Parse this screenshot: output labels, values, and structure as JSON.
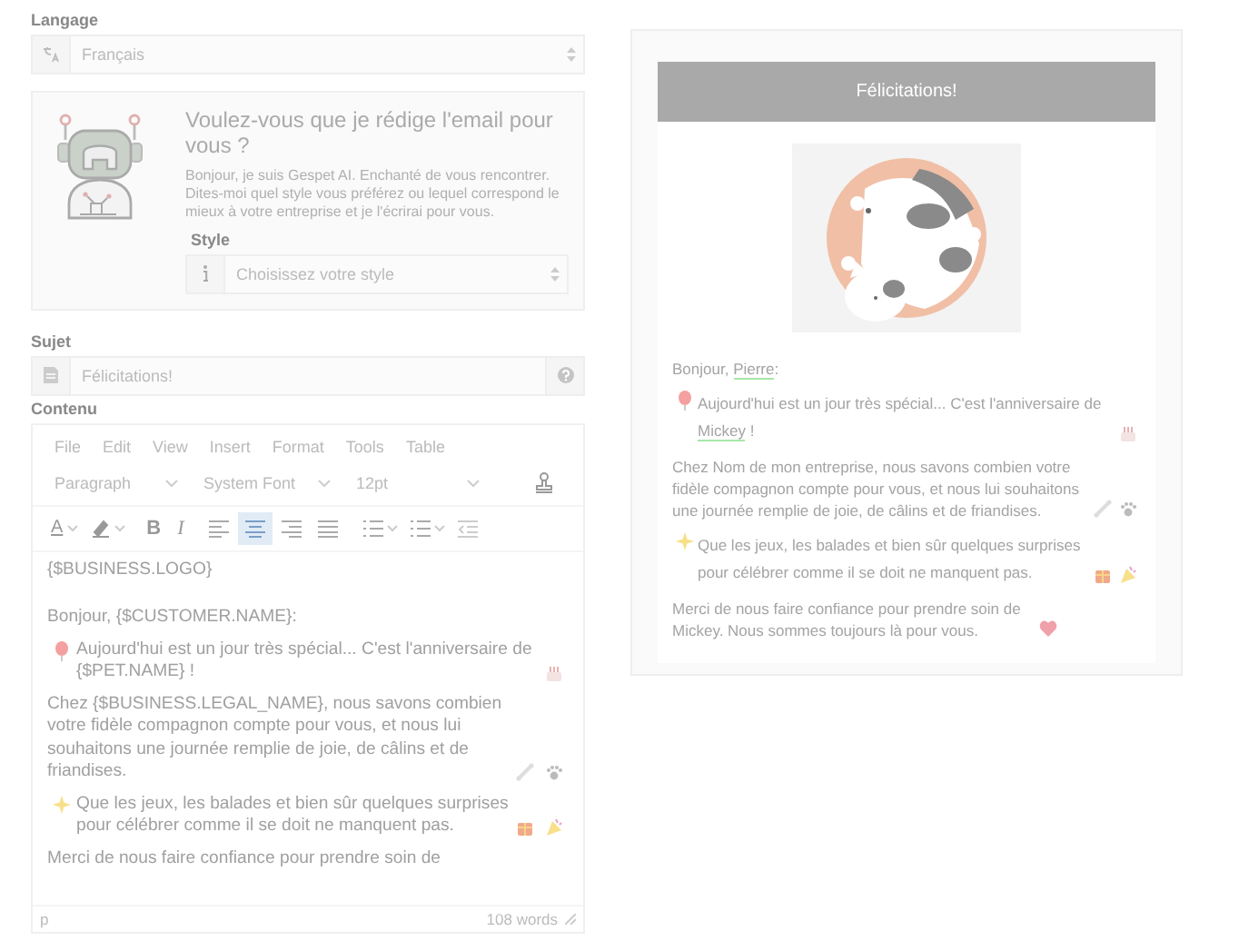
{
  "language": {
    "label": "Langage",
    "value": "Français"
  },
  "assistant": {
    "title": "Voulez-vous que je rédige l'email pour vous ?",
    "text": "Bonjour, je suis Gespet AI. Enchanté de vous rencontrer. Dites-moi quel style vous préférez ou lequel correspond le mieux à votre entreprise et je l'écrirai pour vous.",
    "style": {
      "label": "Style",
      "placeholder": "Choisissez votre style"
    }
  },
  "subject": {
    "label": "Sujet",
    "value": "Félicitations!"
  },
  "content": {
    "label": "Contenu",
    "menu": [
      "File",
      "Edit",
      "View",
      "Insert",
      "Format",
      "Tools",
      "Table"
    ],
    "block_format": "Paragraph",
    "font_family": "System Font",
    "font_size": "12pt",
    "toolbar": [
      {
        "kind": "text-color",
        "label": "A",
        "selected": false
      },
      {
        "kind": "highlight",
        "selected": false
      },
      {
        "kind": "bold",
        "label": "B",
        "selected": false
      },
      {
        "kind": "italic",
        "label": "I",
        "selected": false
      },
      {
        "kind": "align-left",
        "selected": false
      },
      {
        "kind": "align-center",
        "selected": true
      },
      {
        "kind": "align-right",
        "selected": false
      },
      {
        "kind": "justify",
        "selected": false
      },
      {
        "kind": "bullet-list",
        "selected": false
      },
      {
        "kind": "numbered-list",
        "selected": false
      },
      {
        "kind": "outdent",
        "selected": false
      }
    ],
    "body": [
      {
        "kind": "logo",
        "parts": [
          {
            "text": "{$BUSINESS.LOGO}",
            "merge": false
          }
        ]
      },
      {
        "kind": "greeting",
        "parts": [
          {
            "text": "Bonjour, {$CUSTOMER.NAME}:",
            "merge": false
          }
        ]
      },
      {
        "kind": "birthday",
        "parts": [
          {
            "text": "Aujourd'hui est un jour très spécial... C'est l'anniversaire de {$PET.NAME} !",
            "merge": false
          }
        ]
      },
      {
        "kind": "treats",
        "parts": [
          {
            "text": "Chez {$BUSINESS.LEGAL_NAME}, nous savons combien votre fidèle compagnon compte pour vous, et nous lui souhaitons une journée remplie de joie, de câlins et de friandises.",
            "merge": false
          }
        ]
      },
      {
        "kind": "wishes",
        "parts": [
          {
            "text": "Que les jeux, les balades et bien sûr quelques surprises pour célébrer comme il se doit ne manquent pas.",
            "merge": false
          }
        ]
      },
      {
        "kind": "thanks-cut",
        "parts": [
          {
            "text": "Merci de nous faire confiance pour prendre soin de",
            "merge": false
          }
        ]
      }
    ],
    "status_path": "p",
    "word_count": "108 words"
  },
  "preview": {
    "header": "Félicitations!",
    "body": [
      {
        "kind": "greeting",
        "parts": [
          {
            "text": "Bonjour, ",
            "merge": false
          },
          {
            "text": "Pierre",
            "merge": true
          },
          {
            "text": ":",
            "merge": false
          }
        ]
      },
      {
        "kind": "birthday",
        "parts": [
          {
            "text": "Aujourd'hui est un jour très spécial... C'est l'anniversaire de ",
            "merge": false
          },
          {
            "text": "Mickey",
            "merge": true
          },
          {
            "text": " !",
            "merge": false
          }
        ]
      },
      {
        "kind": "treats",
        "parts": [
          {
            "text": "Chez Nom de mon entreprise, nous savons combien votre fidèle compagnon compte pour vous, et nous lui souhaitons une journée remplie de joie, de câlins et de friandises.",
            "merge": false
          }
        ]
      },
      {
        "kind": "wishes",
        "parts": [
          {
            "text": "Que les jeux, les balades et bien sûr quelques surprises pour célébrer comme il se doit ne manquent pas.",
            "merge": false
          }
        ]
      },
      {
        "kind": "thanks",
        "parts": [
          {
            "text": "Merci de nous faire confiance pour prendre soin de Mickey. Nous sommes toujours là pour vous.",
            "merge": false
          }
        ]
      }
    ]
  }
}
